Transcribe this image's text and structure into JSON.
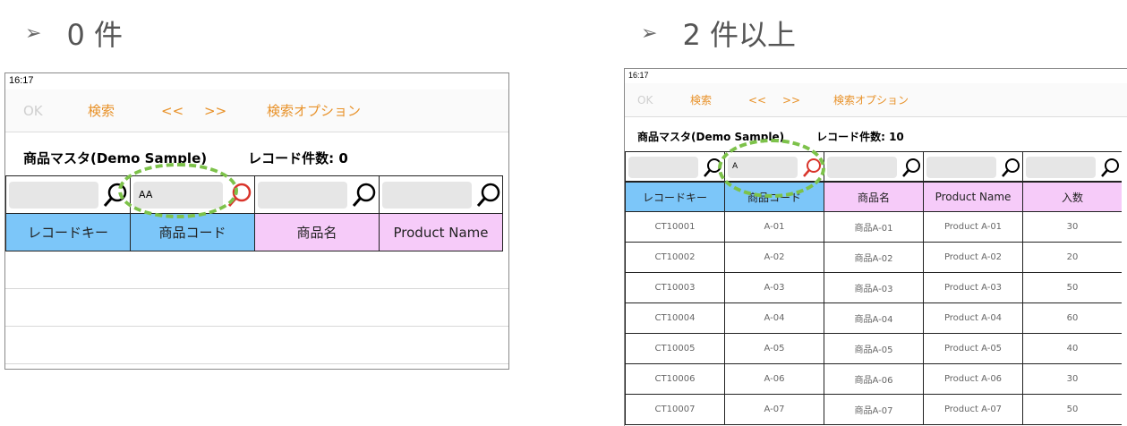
{
  "headings": {
    "zero": {
      "arrow": "➢",
      "label": "0 件"
    },
    "multiple": {
      "arrow": "➢",
      "label": "2 件以上"
    }
  },
  "colors": {
    "accent": "#e8922a",
    "header_blue": "#7cc6f9",
    "header_pink": "#f6cbf9",
    "highlight": "#7dc24a",
    "clear_icon": "#d9342b"
  },
  "left": {
    "status_time": "16:17",
    "toolbar": {
      "ok": "OK",
      "search": "検索",
      "prev": "<<",
      "next": ">>",
      "options": "検索オプション"
    },
    "table_name": "商品マスタ(Demo Sample)",
    "record_count": "レコード件数: 0",
    "search_values": [
      "",
      "AA",
      "",
      ""
    ],
    "columns": [
      "レコードキー",
      "商品コード",
      "商品名",
      "Product Name"
    ]
  },
  "right": {
    "status_time": "16:17",
    "toolbar": {
      "ok": "OK",
      "search": "検索",
      "prev": "<<",
      "next": ">>",
      "options": "検索オプション"
    },
    "table_name": "商品マスタ(Demo Sample)",
    "record_count": "レコード件数: 10",
    "search_values": [
      "",
      "A",
      "",
      "",
      ""
    ],
    "columns": [
      "レコードキー",
      "商品コード",
      "商品名",
      "Product Name",
      "入数"
    ],
    "rows": [
      [
        "CT10001",
        "A-01",
        "商品A-01",
        "Product A-01",
        "30"
      ],
      [
        "CT10002",
        "A-02",
        "商品A-02",
        "Product A-02",
        "20"
      ],
      [
        "CT10003",
        "A-03",
        "商品A-03",
        "Product A-03",
        "50"
      ],
      [
        "CT10004",
        "A-04",
        "商品A-04",
        "Product A-04",
        "60"
      ],
      [
        "CT10005",
        "A-05",
        "商品A-05",
        "Product A-05",
        "40"
      ],
      [
        "CT10006",
        "A-06",
        "商品A-06",
        "Product A-06",
        "30"
      ],
      [
        "CT10007",
        "A-07",
        "商品A-07",
        "Product A-07",
        "50"
      ]
    ]
  }
}
